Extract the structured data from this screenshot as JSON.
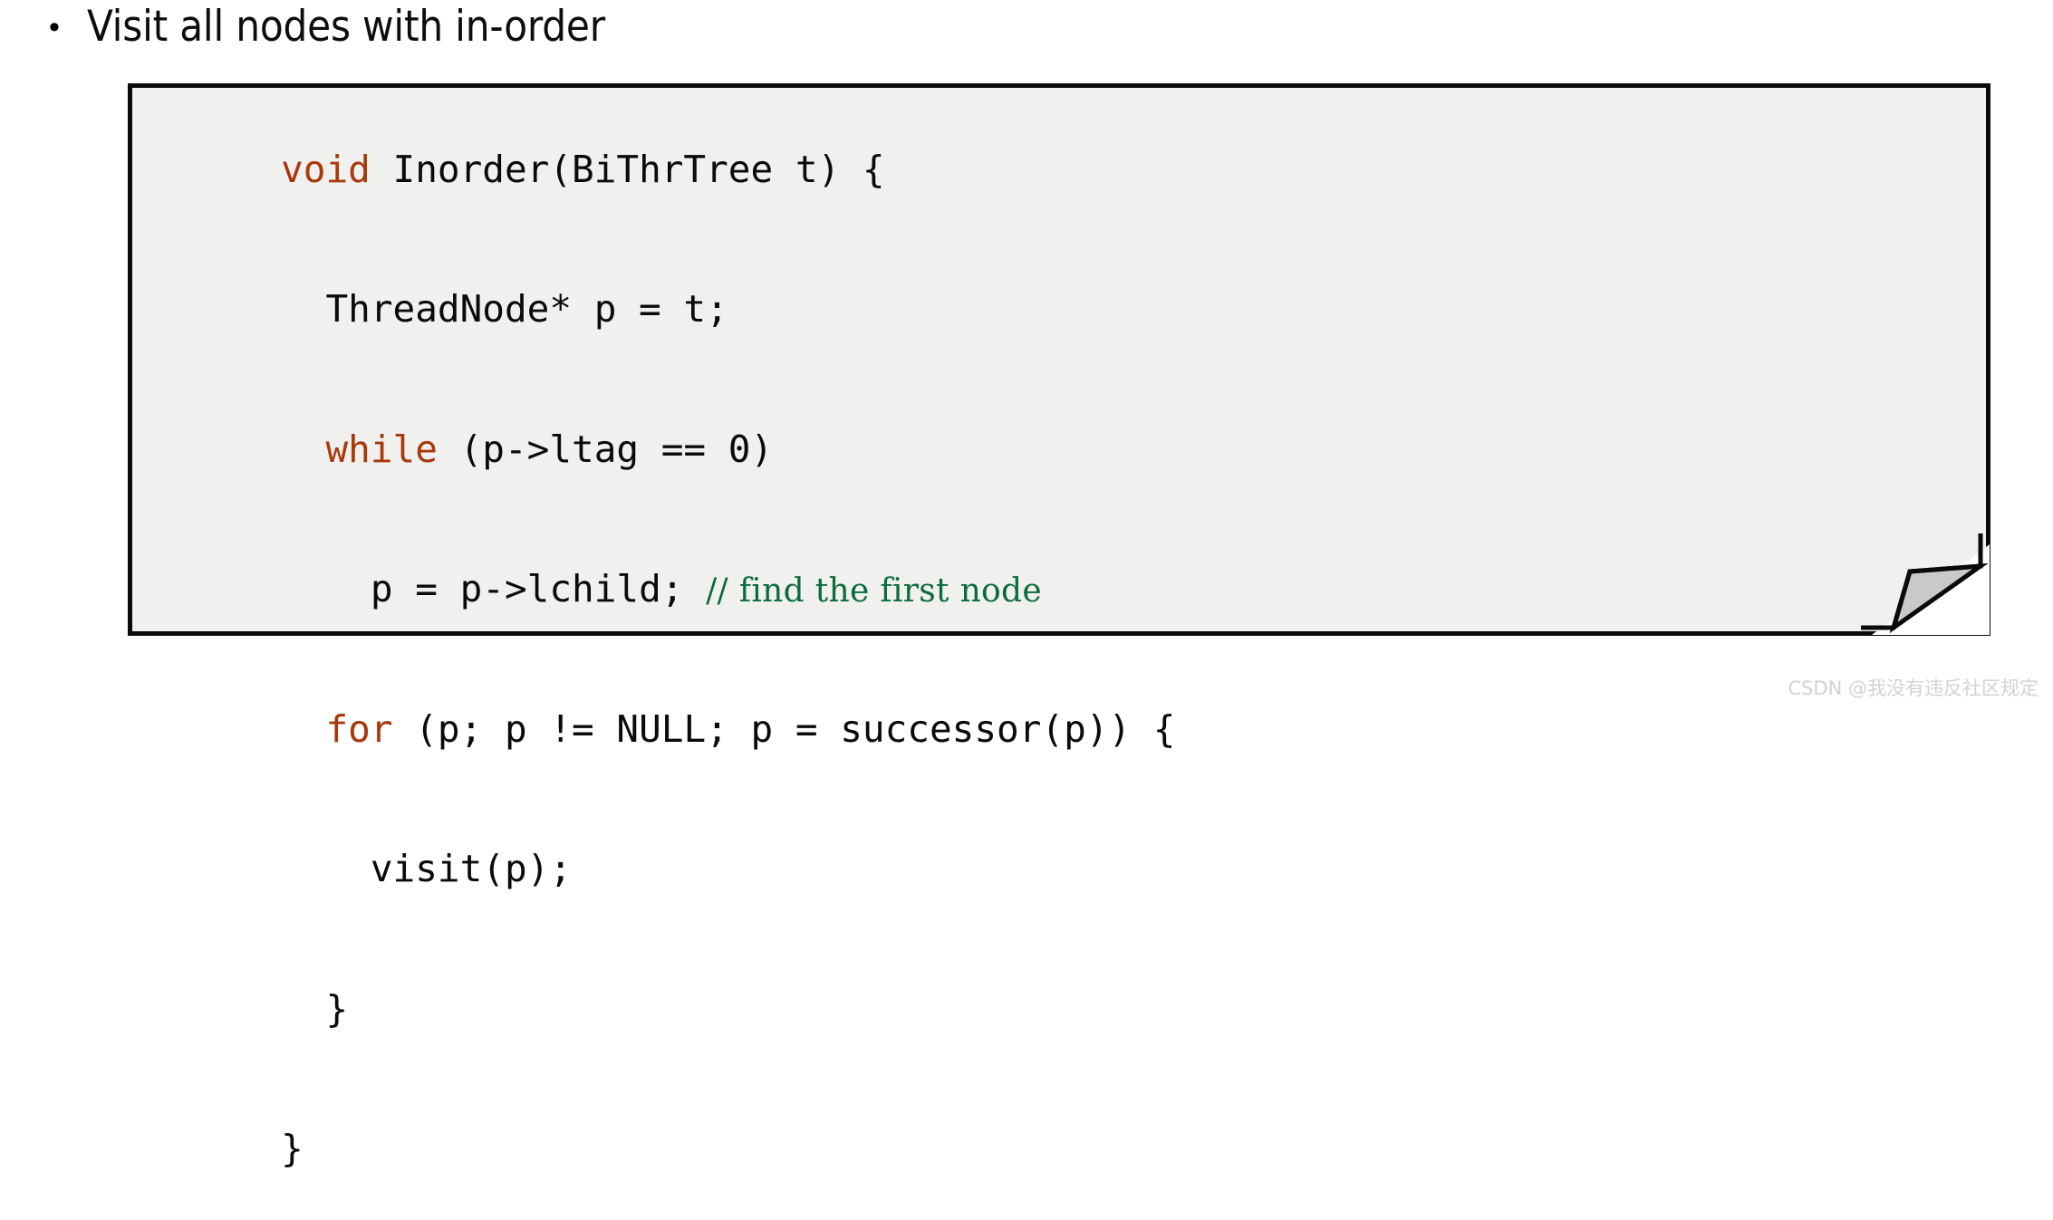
{
  "slide": {
    "bullet": {
      "marker": "•",
      "text": "Visit all nodes with in-order"
    }
  },
  "code_block": {
    "background_color": "#f0f0ef",
    "border_color": "#0a0a0a",
    "keyword_color": "#a8390d",
    "comment_color": "#0b6b3a",
    "text_color": "#0a0a0a",
    "lines": [
      {
        "indent": "",
        "keyword": "void",
        "rest": " Inorder(BiThrTree t) {",
        "comment": ""
      },
      {
        "indent": "  ",
        "keyword": "",
        "rest": "ThreadNode* p = t;",
        "comment": ""
      },
      {
        "indent": "  ",
        "keyword": "while",
        "rest": " (p->ltag == 0)",
        "comment": ""
      },
      {
        "indent": "    ",
        "keyword": "",
        "rest": "p = p->lchild; ",
        "comment": "// find the first node"
      },
      {
        "indent": "  ",
        "keyword": "for",
        "rest": " (p; p != NULL; p = successor(p)) {",
        "comment": ""
      },
      {
        "indent": "    ",
        "keyword": "",
        "rest": "visit(p);",
        "comment": ""
      },
      {
        "indent": "  ",
        "keyword": "",
        "rest": "}",
        "comment": ""
      },
      {
        "indent": "",
        "keyword": "",
        "rest": "}",
        "comment": ""
      }
    ]
  },
  "corner_fold": {
    "fill_color": "#c9c9c9",
    "stroke_color": "#0a0a0a"
  },
  "watermark": {
    "text": "CSDN @我没有违反社区规定",
    "color": "#d2d2d2"
  }
}
